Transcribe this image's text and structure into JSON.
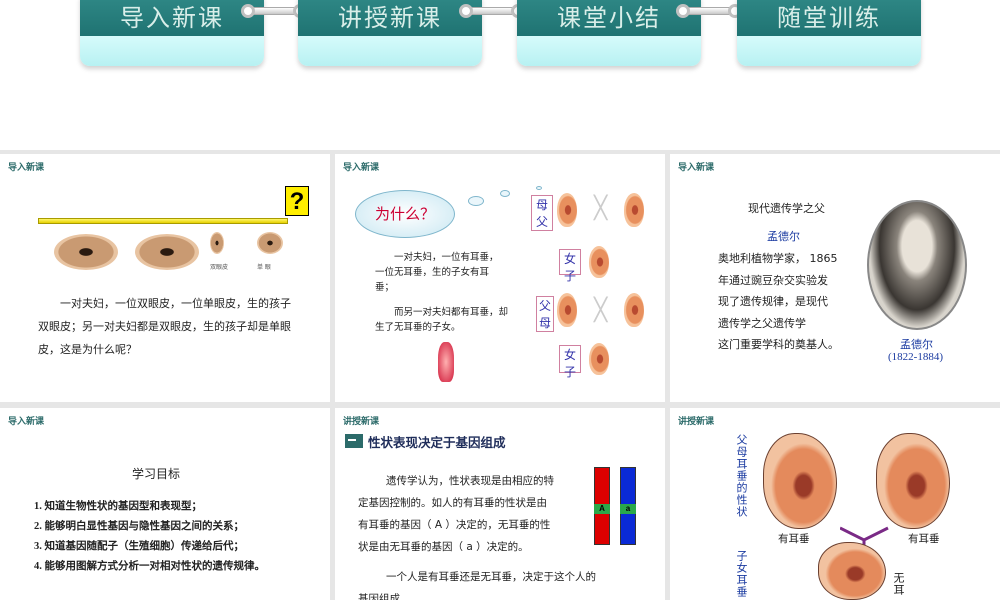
{
  "nav": {
    "tabs": [
      {
        "label": "导入新课"
      },
      {
        "label": "讲授新课"
      },
      {
        "label": "课堂小结"
      },
      {
        "label": "随堂训练"
      }
    ]
  },
  "slides": [
    {
      "tag": "导入新课",
      "question_mark": "?",
      "figure_labels": [
        "双眼皮",
        "单 眼"
      ],
      "text": "一对夫妇，一位双眼皮，一位单眼皮，生的孩子双眼皮；另一对夫妇都是双眼皮，生的孩子却是单眼皮，这是为什么呢？"
    },
    {
      "tag": "导入新课",
      "cloud": "为什么？",
      "para1": "一对夫妇，一位有耳垂，一位无耳垂，生的子女有耳垂；",
      "para2": "而另一对夫妇都有耳垂，却生了无耳垂的子女。",
      "roles": [
        "母 父",
        "女 子",
        "父母",
        "女 子"
      ]
    },
    {
      "tag": "导入新课",
      "title": "现代遗传学之父",
      "name": "孟德尔",
      "bio": [
        "奥地利植物学家， 1865",
        "年通过豌豆杂交实验发",
        "现了遗传规律，是现代",
        "遗传学之父遗传学",
        "这门重要学科的奠基人。"
      ],
      "portrait_name": "孟德尔",
      "portrait_years": "(1822-1884)"
    },
    {
      "tag": "导入新课",
      "title": "学习目标",
      "goals": [
        "1. 知道生物性状的基因型和表现型；",
        "2. 能够明白显性基因与隐性基因之间的关系；",
        "3. 知道基因随配子（生殖细胞）传递给后代；",
        "4. 能够用图解方式分析一对相对性状的遗传规律。"
      ]
    },
    {
      "tag": "讲授新课",
      "heading": "性状表现决定于基因组成",
      "para1": [
        "遗传学认为，性状表现是由相应的特",
        "定基因控制的。如人的有耳垂的性状是由",
        "有耳垂的基因（ A ）决定的，无耳垂的性",
        "状是由无耳垂的基因（ a ）决定的。"
      ],
      "para2": [
        "一个人是有耳垂还是无耳垂，决定于这个人的",
        "基因组成。"
      ],
      "gene_labels": [
        "A",
        "a"
      ],
      "gene_colors": [
        "#dd0000",
        "#0a2ad6"
      ]
    },
    {
      "tag": "讲授新课",
      "parent_label": "父母耳垂的性状",
      "child_label": "子女耳垂",
      "captions": [
        "有耳垂",
        "有耳垂",
        "无耳"
      ]
    }
  ]
}
